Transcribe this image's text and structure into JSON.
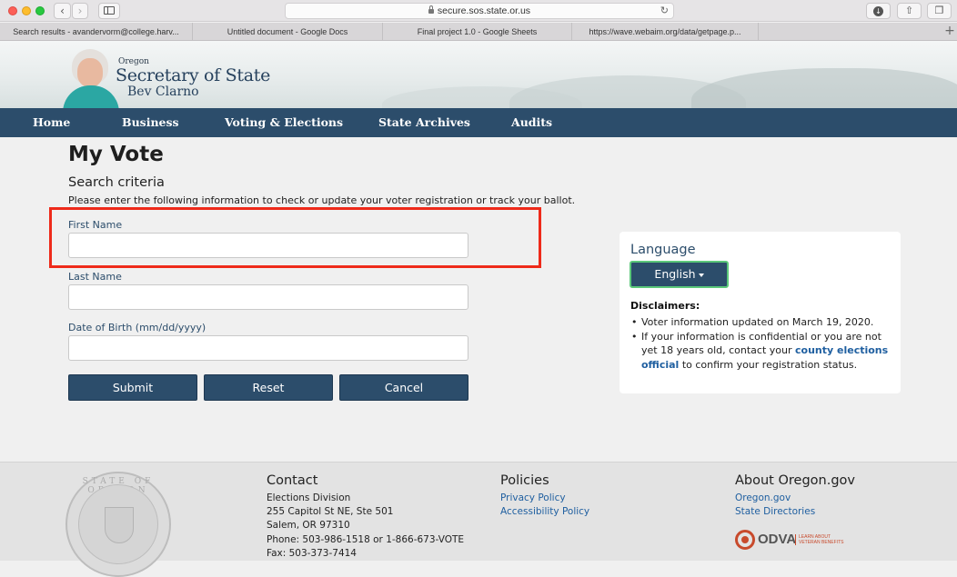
{
  "browser": {
    "url": "secure.sos.state.or.us",
    "tabs": [
      {
        "label": "Search results - avandervorm@college.harv..."
      },
      {
        "label": "Untitled document - Google Docs"
      },
      {
        "label": "Final project 1.0 - Google Sheets"
      },
      {
        "label": "https://wave.webaim.org/data/getpage.p..."
      }
    ],
    "new_tab": "+"
  },
  "header": {
    "state": "Oregon",
    "office": "Secretary of State",
    "name": "Bev Clarno"
  },
  "nav": {
    "items": [
      {
        "label": "Home"
      },
      {
        "label": "Business"
      },
      {
        "label": "Voting & Elections"
      },
      {
        "label": "State Archives"
      },
      {
        "label": "Audits"
      }
    ]
  },
  "main": {
    "title": "My Vote",
    "section": "Search criteria",
    "intro": "Please enter the following information to check or update your voter registration or track your ballot.",
    "fields": {
      "first_name_label": "First Name",
      "last_name_label": "Last Name",
      "dob_label": "Date of Birth (mm/dd/yyyy)"
    },
    "buttons": {
      "submit": "Submit",
      "reset": "Reset",
      "cancel": "Cancel"
    }
  },
  "panel": {
    "language_title": "Language",
    "language_value": "English",
    "disclaimers_title": "Disclaimers:",
    "disclaimer_1": "Voter information updated on March 19, 2020.",
    "disclaimer_2_pre": "If your information is confidential or you are not yet 18 years old, contact your",
    "disclaimer_2_link": "county elections official",
    "disclaimer_2_post": "to confirm your registration status."
  },
  "footer": {
    "seal_text": "STATE OF OREGON",
    "contact": {
      "title": "Contact",
      "lines": [
        "Elections Division",
        "255 Capitol St NE, Ste 501",
        "Salem, OR 97310",
        "Phone: 503-986-1518 or 1-866-673-VOTE",
        "Fax: 503-373-7414"
      ]
    },
    "policies": {
      "title": "Policies",
      "links": [
        "Privacy Policy",
        "Accessibility Policy"
      ]
    },
    "about": {
      "title": "About Oregon.gov",
      "links": [
        "Oregon.gov",
        "State Directories"
      ]
    },
    "odva": {
      "name": "ODVA",
      "tagline": "LEARN ABOUT VETERAN BENEFITS"
    }
  },
  "colors": {
    "nav_bg": "#2c4d6b",
    "highlight": "#ee2a1a",
    "link": "#1f5fa0"
  }
}
